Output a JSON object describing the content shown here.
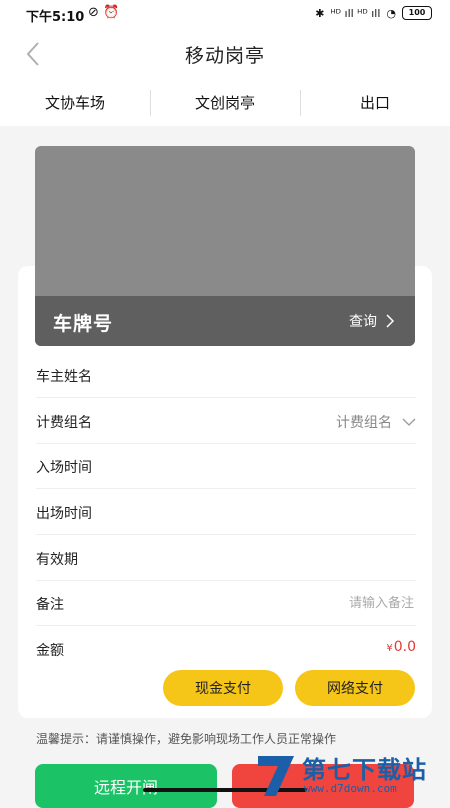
{
  "statusbar": {
    "time": "下午5:10",
    "left_icons": "⊘ ⏰",
    "network": "ᴴᴰ ıll ᴴᴰ ıll",
    "battery": "100"
  },
  "header": {
    "title": "移动岗亭"
  },
  "tabs": [
    {
      "label": "文协车场"
    },
    {
      "label": "文创岗亭"
    },
    {
      "label": "出口"
    }
  ],
  "plate": {
    "label": "车牌号",
    "query_label": "查询"
  },
  "fields": {
    "owner_name": {
      "label": "车主姓名"
    },
    "billing_group": {
      "label": "计费组名",
      "value": "计费组名"
    },
    "entry_time": {
      "label": "入场时间"
    },
    "exit_time": {
      "label": "出场时间"
    },
    "validity": {
      "label": "有效期"
    },
    "remark": {
      "label": "备注",
      "placeholder": "请输入备注"
    },
    "amount": {
      "label": "金额",
      "currency": "¥",
      "value": "0.0"
    }
  },
  "payment": {
    "cash_label": "现金支付",
    "online_label": "网络支付"
  },
  "tip": "温馨提示：请谨慎操作，避免影响现场工作人员正常操作",
  "actions": {
    "remote_open_label": "远程开闸"
  },
  "watermark": {
    "text": "第七下载站",
    "url": "www.d7down.com"
  },
  "colors": {
    "accent_yellow": "#f5c518",
    "green": "#1bc266",
    "red": "#f0443f",
    "amount_red": "#e53935"
  }
}
